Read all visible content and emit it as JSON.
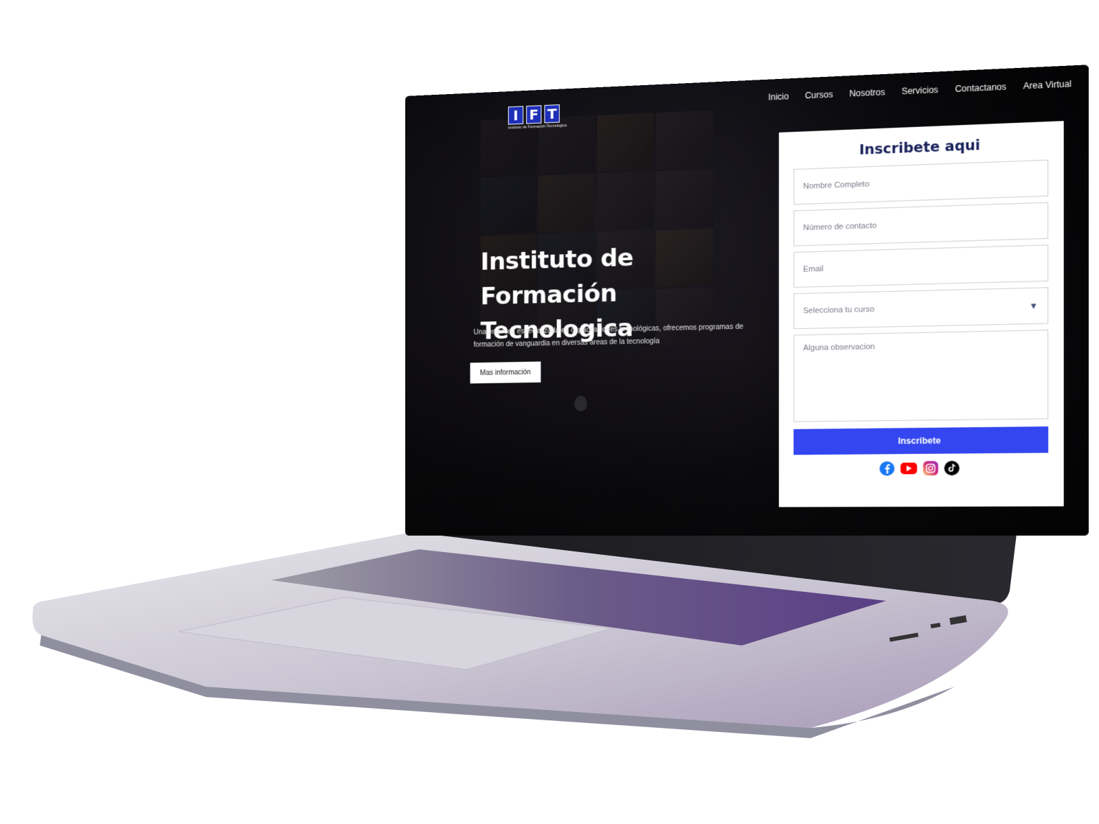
{
  "brand": {
    "letters": [
      "I",
      "F",
      "T"
    ],
    "subtitle": "Instituto de Formación Tecnologica",
    "accent": "#1e2fb8"
  },
  "nav": {
    "items": [
      "Inicio",
      "Cursos",
      "Nosotros",
      "Servicios",
      "Contactanos",
      "Area Virtual"
    ]
  },
  "hero": {
    "title": "Instituto de Formación Tecnologica",
    "description": "Una empresa especializada en capacitaciones tecnológicas, ofrecemos programas de formación de vanguardia en diversas áreas de la tecnología",
    "button_label": "Mas información"
  },
  "form": {
    "title": "Inscribete aqui",
    "name_placeholder": "Nombre Completo",
    "phone_placeholder": "Número de contacto",
    "email_placeholder": "Email",
    "course_select_value": "Selecciona tu curso",
    "notes_placeholder": "Alguna observacion",
    "submit_label": "Inscribete",
    "submit_color": "#3346ef"
  },
  "socials": [
    "facebook-icon",
    "youtube-icon",
    "instagram-icon",
    "tiktok-icon"
  ]
}
